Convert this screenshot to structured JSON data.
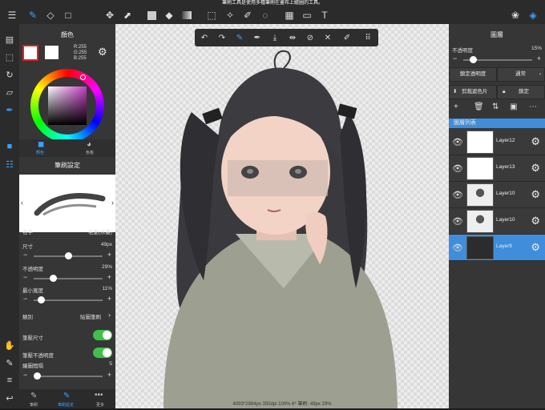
{
  "hint": "筆刷工具是使用多種筆刷在畫布上繪圖的工具。",
  "toolbar": {
    "icons": [
      "menu-icon",
      "brush-icon",
      "eraser-icon",
      "rect-icon",
      "move-icon",
      "transform-icon",
      "fill-color-icon",
      "bucket-icon",
      "gradient-icon",
      "select-icon",
      "magic-wand-icon",
      "pen-icon",
      "lasso-fill-icon",
      "filter-icon",
      "text-icon",
      "materials-icon",
      "layers-icon"
    ]
  },
  "color_panel": {
    "title": "顏色",
    "rgb": {
      "r": "R:255",
      "g": "G:255",
      "b": "B:255"
    },
    "tab_color": "顏色",
    "tab_palette": "色板",
    "primary": "#ffffff",
    "accent": "#3aa0ff"
  },
  "brush_settings": {
    "title": "筆刷設定",
    "name_label": "名字",
    "name_value": "毛筆(水墨)",
    "size_label": "尺寸",
    "size_value": "49px",
    "size_level": 0.5,
    "opacity_label": "不透明度",
    "opacity_value": "29%",
    "opacity_level": 0.29,
    "minwidth_label": "最小寬度",
    "minwidth_value": "11%",
    "minwidth_level": 0.11,
    "type_label": "類別",
    "type_value": "貼圖筆刷",
    "pressure_size_label": "筆壓尺寸",
    "pressure_opacity_label": "筆壓不透明度",
    "spacing_label": "繪圖間隔",
    "spacing_value": "5",
    "spacing_level": 0.05,
    "bottom_tabs": [
      "筆刷",
      "筆刷設定",
      "更多"
    ]
  },
  "layer_panel": {
    "title": "圖層",
    "opacity_label": "不透明度",
    "opacity_value": "15%",
    "opacity_level": 0.15,
    "lock_alpha": "鎖定透明度",
    "blend_mode": "通常",
    "clipping": "剪裁遮色片",
    "lock": "鎖定",
    "list_title": "圖層列表",
    "layers": [
      {
        "name": "Layer12",
        "selected": false
      },
      {
        "name": "Layer13",
        "selected": false
      },
      {
        "name": "Layer10",
        "selected": false
      },
      {
        "name": "Layer10",
        "selected": false
      },
      {
        "name": "Layer9",
        "selected": true
      }
    ]
  },
  "status": "4093*2894px 350dpi 100% 6* 筆刷: 49px 29%"
}
